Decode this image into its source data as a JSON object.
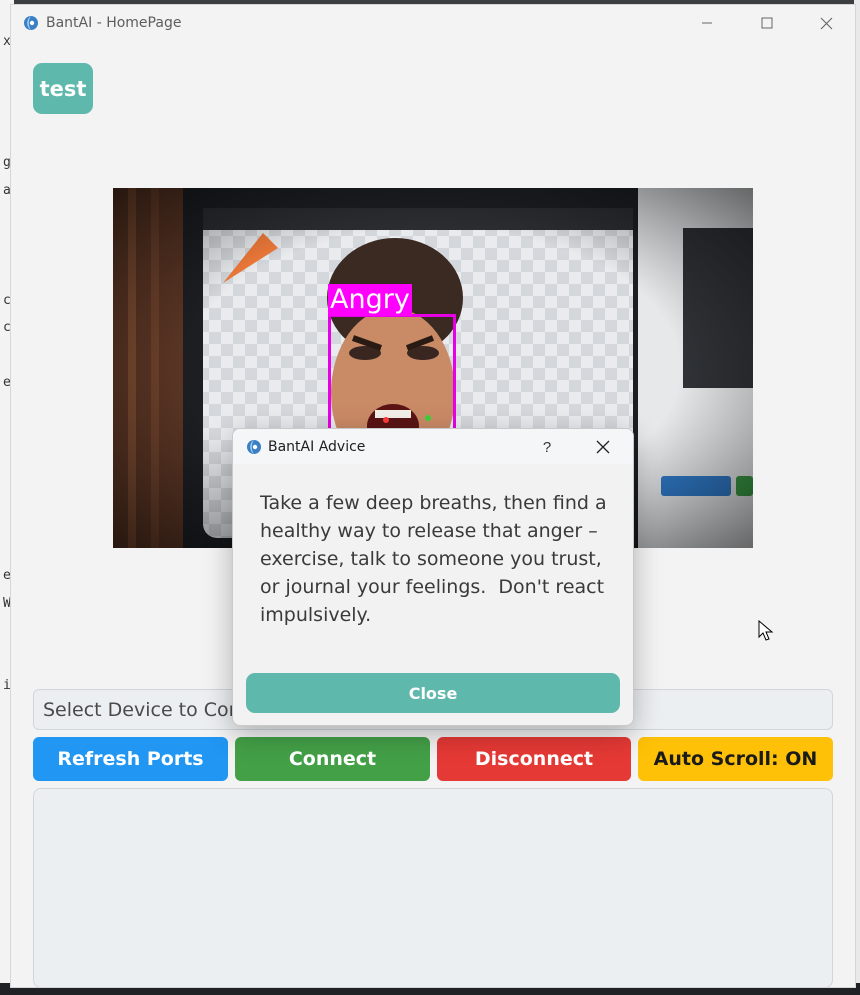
{
  "window": {
    "title": "BantAI - HomePage"
  },
  "header": {
    "test_button_label": "test"
  },
  "camera": {
    "detection_label": "Angry",
    "detection_color": "#ff00ff"
  },
  "device": {
    "select_placeholder": "Select Device to Connect"
  },
  "controls": {
    "refresh_label": "Refresh Ports",
    "connect_label": "Connect",
    "disconnect_label": "Disconnect",
    "autoscroll_label": "Auto Scroll: ON"
  },
  "dialog": {
    "title": "BantAI Advice",
    "help_label": "?",
    "message": "Take a few deep breaths, then find a healthy way to release that anger – exercise, talk to someone you trust, or journal your feelings.  Don't react impulsively.",
    "close_label": "Close"
  },
  "colors": {
    "accent": "#5fb8ac",
    "refresh": "#2196f3",
    "connect": "#43a047",
    "disconnect": "#e53935",
    "autoscroll": "#ffc107"
  }
}
